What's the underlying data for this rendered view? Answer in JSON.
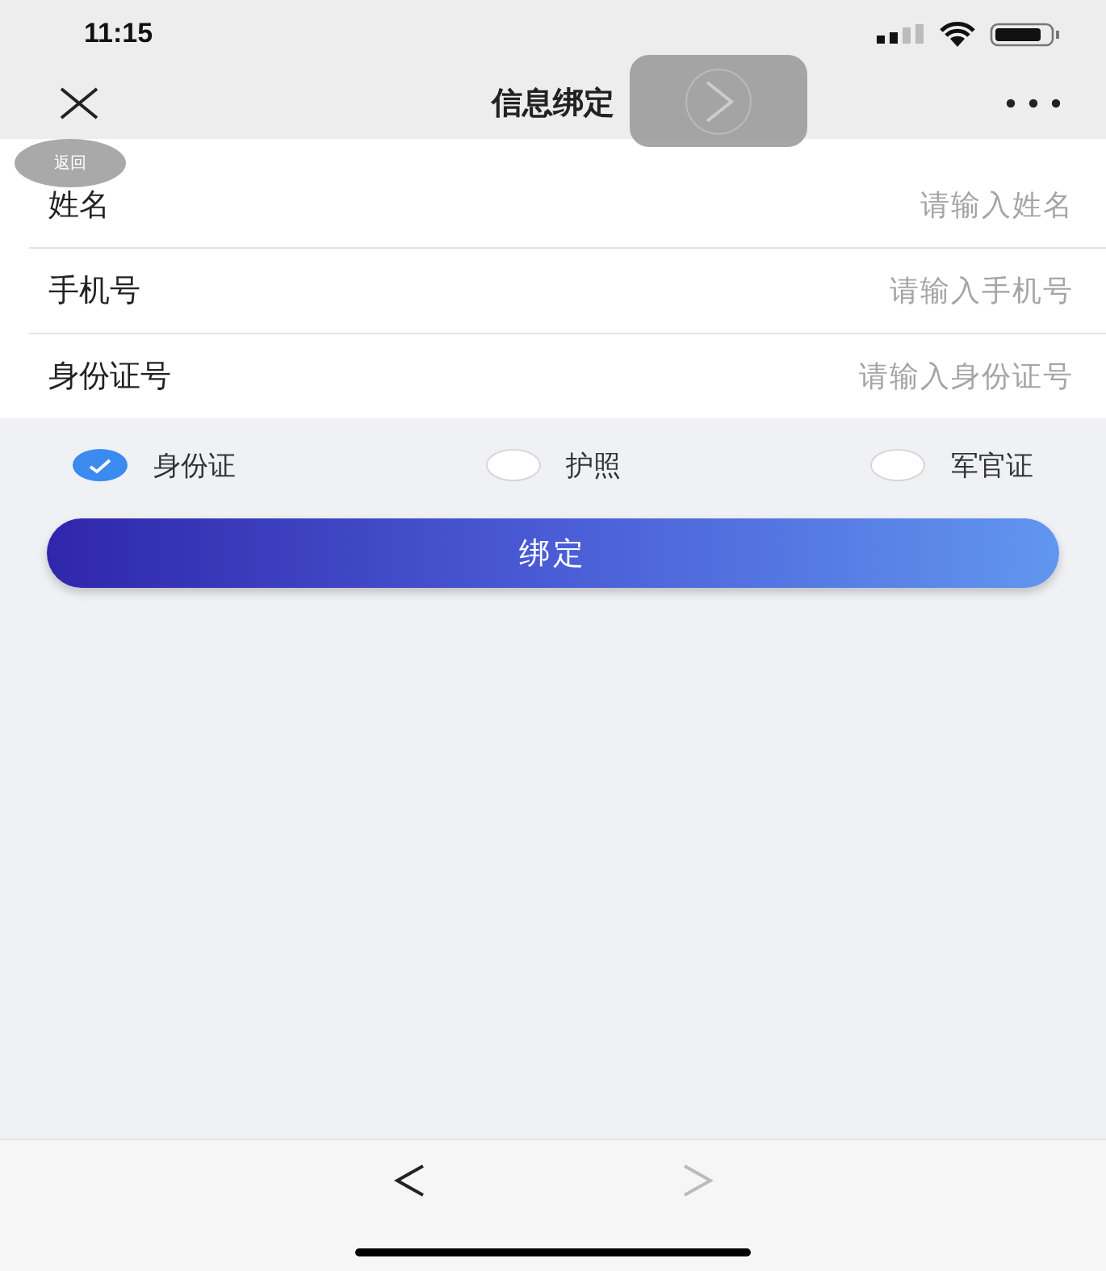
{
  "status_bar": {
    "time": "11:15"
  },
  "nav": {
    "title": "信息绑定"
  },
  "floating_back": {
    "label": "返回"
  },
  "fields": [
    {
      "label": "姓名",
      "placeholder": "请输入姓名"
    },
    {
      "label": "手机号",
      "placeholder": "请输入手机号"
    },
    {
      "label": "身份证号",
      "placeholder": "请输入身份证号"
    }
  ],
  "id_types": [
    {
      "label": "身份证",
      "selected": true
    },
    {
      "label": "护照",
      "selected": false
    },
    {
      "label": "军官证",
      "selected": false
    }
  ],
  "submit": {
    "label": "绑定"
  },
  "browser_nav": {
    "back_disabled": false,
    "forward_disabled": true
  }
}
